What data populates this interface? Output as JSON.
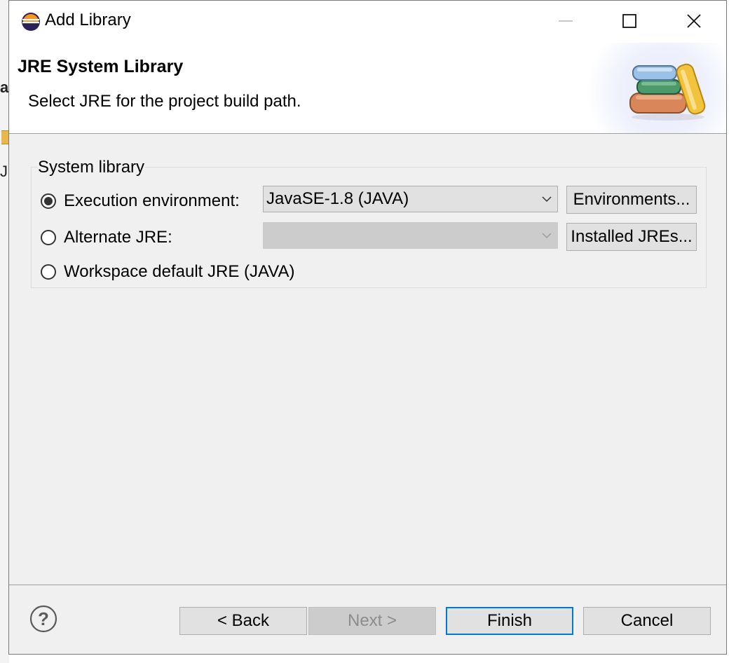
{
  "background": {
    "fragment_a": "a",
    "fragment_j": "J"
  },
  "window": {
    "title": "Add Library",
    "app_icon": "eclipse-icon",
    "controls": {
      "minimize": "minimize-icon",
      "maximize": "maximize-icon",
      "close": "close-icon"
    }
  },
  "banner": {
    "title": "JRE System Library",
    "description": "Select JRE for the project build path.",
    "icon": "library-books-icon"
  },
  "group": {
    "label": "System library",
    "options": [
      {
        "label": "Execution environment:",
        "checked": true
      },
      {
        "label": "Alternate JRE:",
        "checked": false
      },
      {
        "label": "Workspace default JRE (JAVA)",
        "checked": false
      }
    ],
    "exec_env_value": "JavaSE-1.8 (JAVA)",
    "alternate_jre_value": "",
    "environments_button": "Environments...",
    "installed_jres_button": "Installed JREs..."
  },
  "footer": {
    "help_icon": "help-icon",
    "back": "< Back",
    "next": "Next >",
    "finish": "Finish",
    "cancel": "Cancel"
  },
  "colors": {
    "accent": "#0078d7",
    "dialog_bg": "#f0f0f0",
    "button_bg": "#e1e1e1",
    "disabled_bg": "#cccccc"
  }
}
